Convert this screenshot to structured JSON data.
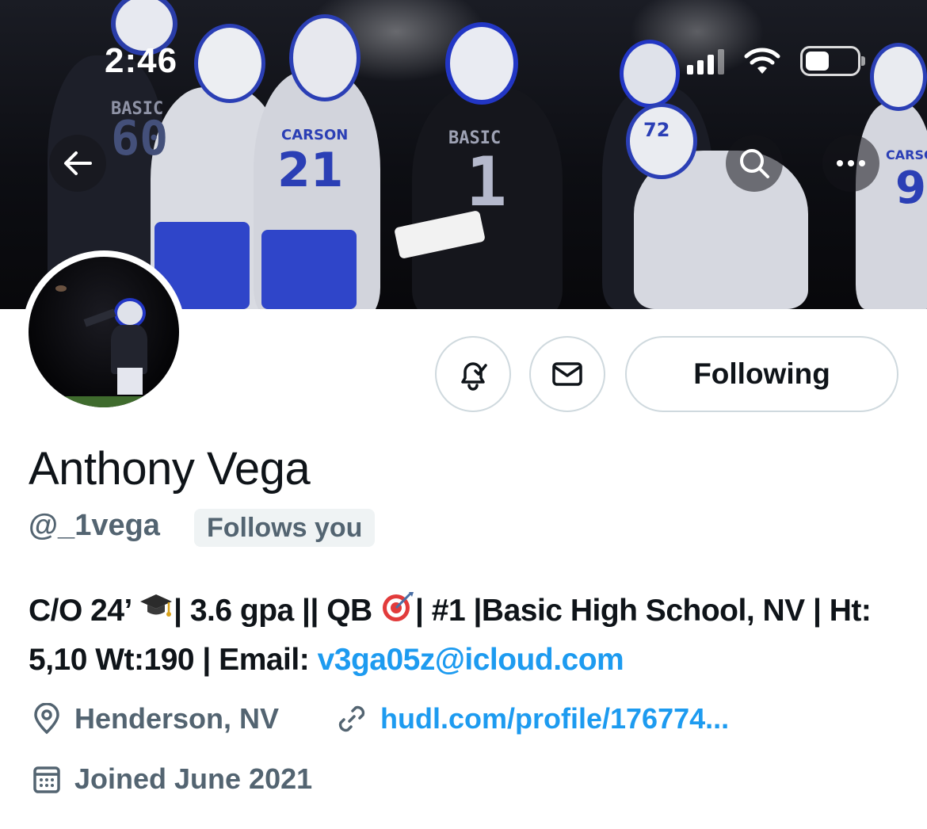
{
  "status_bar": {
    "time": "2:46"
  },
  "banner": {
    "jersey_numbers": [
      "1",
      "60",
      "21",
      "72",
      "9"
    ],
    "jersey_texts": [
      "BASIC",
      "CARSON",
      "CARSON",
      "BASIC"
    ]
  },
  "nav": {
    "back_icon": "arrow-left-icon",
    "search_icon": "search-icon",
    "more_icon": "more-icon"
  },
  "actions": {
    "notify_icon": "bell-check-icon",
    "message_icon": "envelope-icon",
    "follow_label": "Following"
  },
  "profile": {
    "name": "Anthony Vega",
    "handle": "@_1vega",
    "follows_you": "Follows you",
    "bio_part1": "C/O 24’ ",
    "bio_part2": "| 3.6 gpa || QB ",
    "bio_part3": "| #1 |Basic High School, NV | Ht: 5,10 Wt:190 | Email: ",
    "bio_email": "v3ga05z@icloud.com",
    "location": "Henderson, NV",
    "website": "hudl.com/profile/176774...",
    "joined": "Joined June 2021"
  },
  "colors": {
    "link": "#1d9bf0",
    "secondary_text": "#536471",
    "border": "#cfd9de"
  }
}
